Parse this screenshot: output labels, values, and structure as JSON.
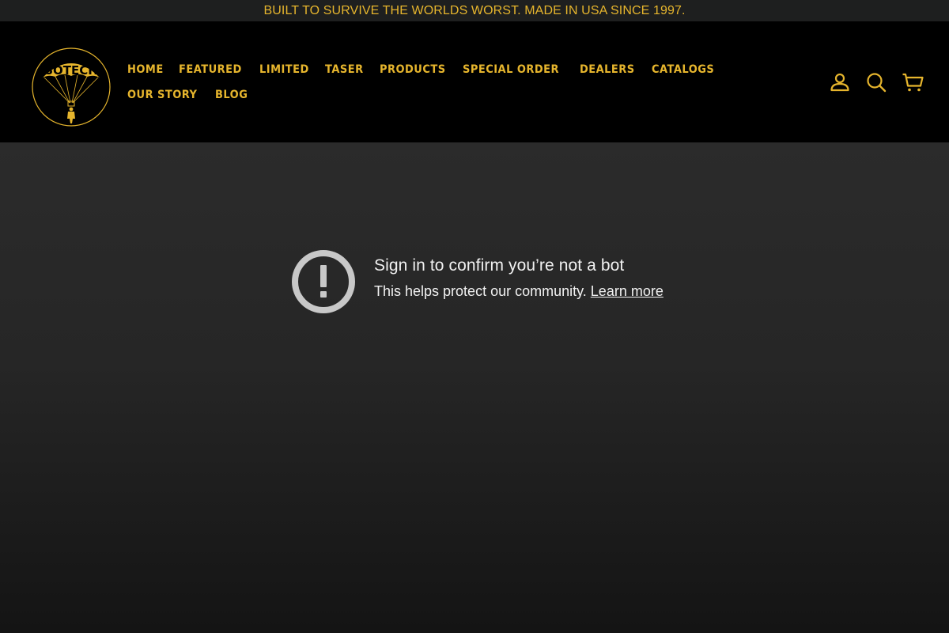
{
  "announcement": {
    "text": "BUILT TO SURVIVE THE WORLDS WORST. MADE IN USA SINCE 1997."
  },
  "brand": {
    "logo_text": "SOTECH",
    "accent_color": "#e6b52d"
  },
  "nav": {
    "items": [
      {
        "label": "HOME"
      },
      {
        "label": "FEATURED"
      },
      {
        "label": "LIMITED"
      },
      {
        "label": "TASER"
      },
      {
        "label": "PRODUCTS"
      },
      {
        "label": "SPECIAL ORDER"
      },
      {
        "label": "DEALERS"
      },
      {
        "label": "CATALOGS"
      },
      {
        "label": "OUR STORY"
      },
      {
        "label": "BLOG"
      }
    ]
  },
  "header_icons": {
    "account": "user-icon",
    "search": "search-icon",
    "cart": "cart-icon"
  },
  "notice": {
    "icon": "exclamation-circle-icon",
    "title": "Sign in to confirm you’re not a bot",
    "body": "This helps protect our community.",
    "link": "Learn more"
  }
}
